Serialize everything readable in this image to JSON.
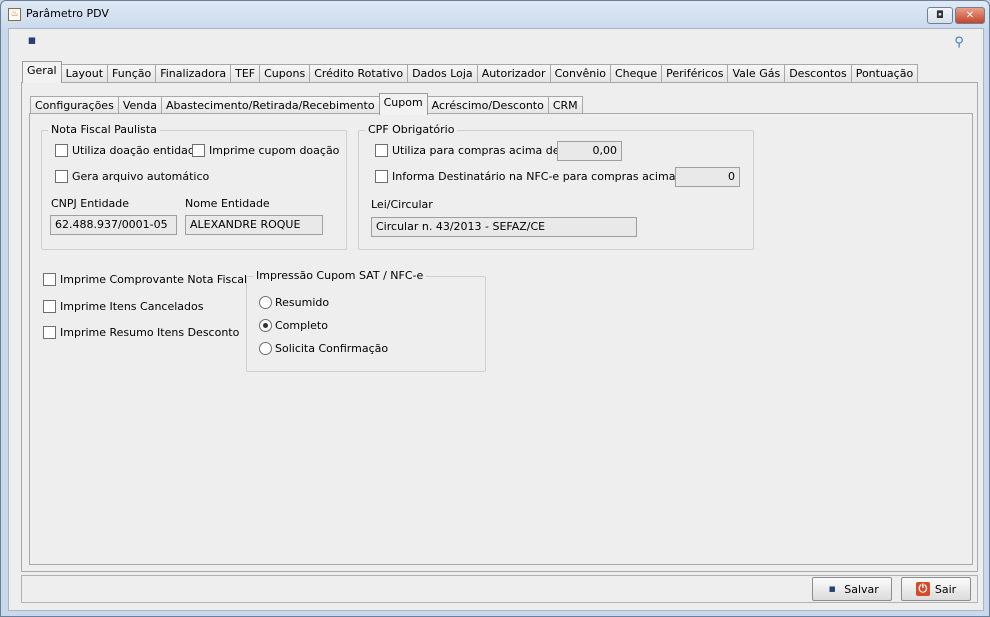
{
  "window": {
    "title": "Parâmetro PDV",
    "app_icon": "java-icon",
    "maximize_glyph": "◘",
    "close_glyph": "✕"
  },
  "toolbar": {
    "save_icon": "floppy-disk-icon",
    "save_glyph": "▪",
    "key_icon": "key-icon",
    "key_glyph": "⚲"
  },
  "outer_tabs": [
    "Geral",
    "Layout",
    "Função",
    "Finalizadora",
    "TEF",
    "Cupons",
    "Crédito Rotativo",
    "Dados Loja",
    "Autorizador",
    "Convênio",
    "Cheque",
    "Periféricos",
    "Vale Gás",
    "Descontos",
    "Pontuação"
  ],
  "outer_active": "Geral",
  "inner_tabs": [
    "Configurações",
    "Venda",
    "Abastecimento/Retirada/Recebimento",
    "Cupom",
    "Acréscimo/Desconto",
    "CRM"
  ],
  "inner_active": "Cupom",
  "nfp": {
    "title": "Nota Fiscal Paulista",
    "utiliza_doacao": "Utiliza doação entidade",
    "imprime_cupom_doacao": "Imprime cupom doação",
    "gera_arquivo": "Gera arquivo automático",
    "cnpj_label": "CNPJ Entidade",
    "cnpj_value": "62.488.937/0001-05",
    "nome_label": "Nome Entidade",
    "nome_value": "ALEXANDRE ROQUE"
  },
  "cpf": {
    "title": "CPF Obrigatório",
    "utiliza_label": "Utiliza para compras acima de R$",
    "utiliza_value": "0,00",
    "informa_label": "Informa Destinatário na NFC-e para compras acima de R$",
    "informa_value": "0",
    "lei_label": "Lei/Circular",
    "lei_value": "Circular n. 43/2013 - SEFAZ/CE"
  },
  "options": {
    "comprovante": "Imprime Comprovante Nota Fiscal",
    "cancelados": "Imprime Itens Cancelados",
    "resumo": "Imprime Resumo Itens Desconto"
  },
  "impressao": {
    "title": "Impressão Cupom SAT / NFC-e",
    "resumido": "Resumido",
    "completo": "Completo",
    "solicita": "Solicita Confirmação",
    "selected": "Completo"
  },
  "buttons": {
    "salvar": "Salvar",
    "salvar_glyph": "▪",
    "sair": "Sair",
    "sair_glyph": "⏻"
  }
}
